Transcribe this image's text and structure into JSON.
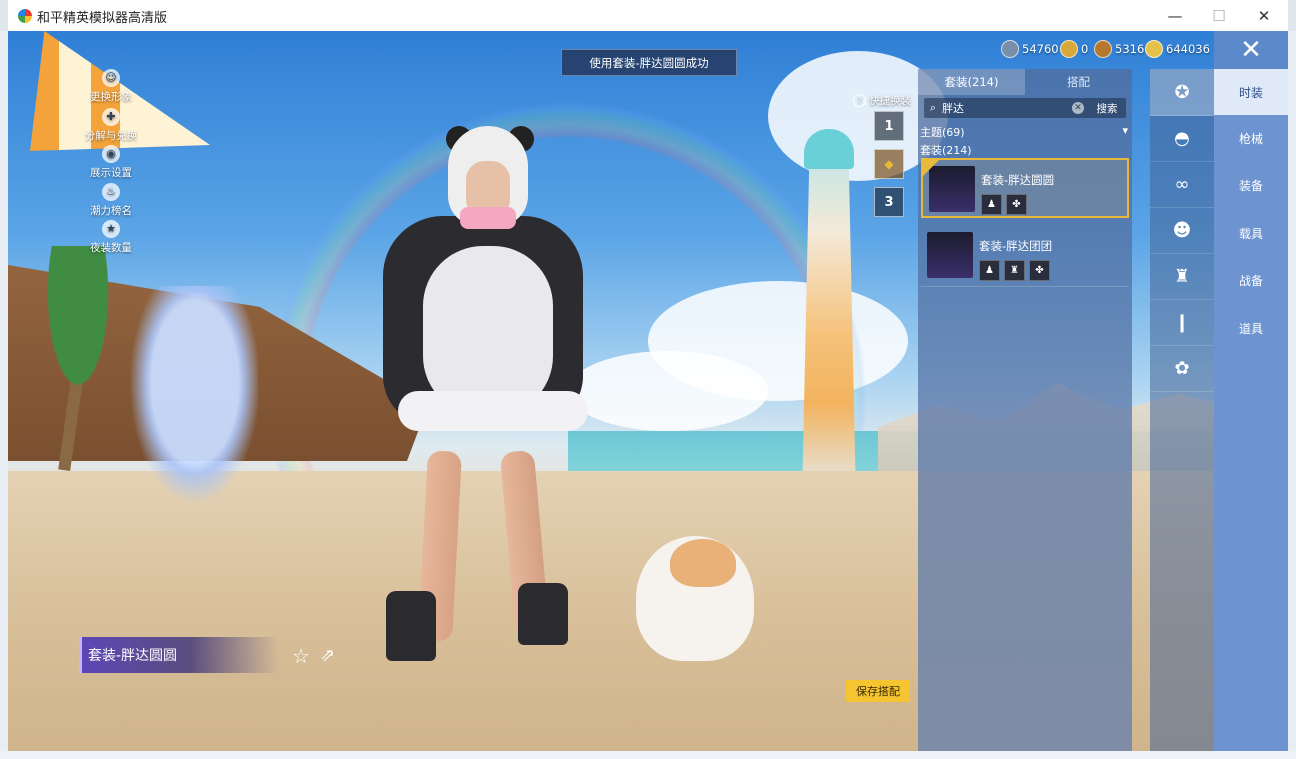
{
  "window": {
    "title": "和平精英模拟器高清版",
    "controls": {
      "minimize": "—",
      "maximize": "☐",
      "close": "✕"
    }
  },
  "toast": "使用套装-胖达圆圆成功",
  "currencies": [
    {
      "icon": "crystal-coin-icon",
      "value": "54760",
      "color": "#7b8ea8"
    },
    {
      "icon": "gold-coin-icon",
      "value": "0",
      "color": "#d9a83a"
    },
    {
      "icon": "bronze-coin-icon",
      "value": "5316",
      "color": "#b5782e"
    },
    {
      "icon": "yellow-coin-icon",
      "value": "644036",
      "color": "#e6c14a"
    }
  ],
  "close_button": "✕",
  "left_menu": [
    {
      "icon": "person-icon",
      "label": "更换形象",
      "glyph": "☺"
    },
    {
      "icon": "share-icon",
      "label": "分解与兑换",
      "glyph": "✚"
    },
    {
      "icon": "eye-icon",
      "label": "展示设置",
      "glyph": "◉"
    },
    {
      "icon": "flame-icon",
      "label": "潮力榜名",
      "glyph": "♨"
    },
    {
      "icon": "badge-icon",
      "label": "夜装数量",
      "glyph": "★"
    }
  ],
  "quick_swap": {
    "label": "快捷换装",
    "help_glyph": "?",
    "slots": [
      "1",
      "",
      "3"
    ]
  },
  "panel": {
    "tabs": [
      {
        "label": "套装(214)",
        "active": true
      },
      {
        "label": "搭配",
        "active": false
      }
    ],
    "search": {
      "value": "胖达",
      "button": "搜索",
      "magnifier": "⌕",
      "clear": "✕"
    },
    "theme": {
      "label": "主题(69)",
      "arrow": "▾"
    },
    "sets_label": "套装(214)",
    "items": [
      {
        "name": "套装-胖达圆圆",
        "selected": true,
        "parts": [
          "♟",
          "✤"
        ]
      },
      {
        "name": "套装-胖达团团",
        "selected": false,
        "parts": [
          "♟",
          "♜",
          "✤"
        ]
      }
    ]
  },
  "categories": [
    {
      "icon": "outfit-icon",
      "glyph": "✪",
      "label": "时装",
      "active": true
    },
    {
      "icon": "cap-icon",
      "glyph": "◓",
      "label": "枪械",
      "active": false
    },
    {
      "icon": "goggles-icon",
      "glyph": "∞",
      "label": "装备",
      "active": false
    },
    {
      "icon": "face-icon",
      "glyph": "☻",
      "label": "载具",
      "active": false
    },
    {
      "icon": "jacket-icon",
      "glyph": "♜",
      "label": "战备",
      "active": false
    },
    {
      "icon": "pants-icon",
      "glyph": "❙",
      "label": "道具",
      "active": false
    },
    {
      "icon": "shoes-icon",
      "glyph": "✿",
      "label": "",
      "active": false
    }
  ],
  "outfit_name": "套装-胖达圆圆",
  "favorite_glyph": "☆",
  "share_glyph": "⇗",
  "save_button": "保存搭配",
  "colors": {
    "accent_gold": "#f5c431",
    "panel_blue": "#6d93d0",
    "selected_border": "#e8b93a"
  }
}
